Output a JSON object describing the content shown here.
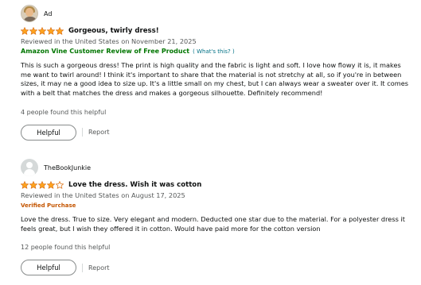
{
  "colors": {
    "star_fill": "#ffa41c",
    "star_stroke": "#de7921",
    "vine_green": "#007600",
    "verified_orange": "#c45500",
    "link_teal": "#007185",
    "muted_text": "#565959"
  },
  "reviews": [
    {
      "profile_name": "Ad",
      "avatar_icon": "user-photo-avatar",
      "rating": 5,
      "title": "Gorgeous, twirly dress!",
      "date": "Reviewed in the United States on November 21, 2025",
      "vine_label": "Amazon Vine Customer Review of Free Product",
      "vine_help": "( What's this? )",
      "body": "This is such a gorgeous dress! The print is high quality and the fabric is light and soft. I love how flowy it is, it makes me want to twirl around! I think it's important to share that the material is not stretchy at all, so if you're in between sizes, it may ne a good idea to size up. It's a little small on my chest, but I can always wear a sweater over it. It comes with a belt that matches the dress and makes a gorgeous silhouette. Definitely recommend!",
      "helpful_count_text": "4 people found this helpful",
      "helpful_button": "Helpful",
      "report_label": "Report"
    },
    {
      "profile_name": "TheBookJunkie",
      "avatar_icon": "default-user-avatar",
      "rating": 4,
      "title": "Love the dress. Wish it was cotton",
      "date": "Reviewed in the United States on August 17, 2025",
      "verified_label": "Verified Purchase",
      "body": "Love the dress. True to size. Very elegant and modern. Deducted one star due to the material. For a polyester dress it feels great, but I wish they offered it in cotton. Would have paid more for the cotton version",
      "helpful_count_text": "12 people found this helpful",
      "helpful_button": "Helpful",
      "report_label": "Report"
    }
  ]
}
